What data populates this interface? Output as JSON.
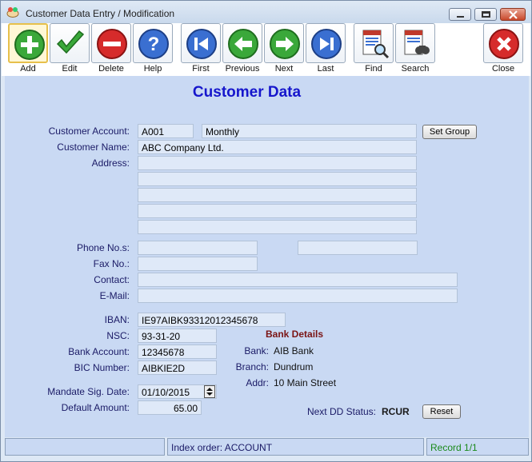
{
  "window": {
    "title": "Customer Data Entry / Modification",
    "controls": [
      "minimize",
      "maximize",
      "close"
    ]
  },
  "toolbar": {
    "buttons": [
      {
        "label": "Add",
        "icon": "add-icon",
        "color": "#3aa83a"
      },
      {
        "label": "Edit",
        "icon": "checkmark-icon",
        "color": "#3aa83a"
      },
      {
        "label": "Delete",
        "icon": "delete-icon",
        "color": "#d62b2b"
      },
      {
        "label": "Help",
        "icon": "help-icon",
        "color": "#3a6fd1"
      },
      {
        "label": "First",
        "icon": "first-record-icon",
        "color": "#3a6fd1"
      },
      {
        "label": "Previous",
        "icon": "previous-icon",
        "color": "#3aa83a"
      },
      {
        "label": "Next",
        "icon": "next-icon",
        "color": "#3aa83a"
      },
      {
        "label": "Last",
        "icon": "last-record-icon",
        "color": "#3a6fd1"
      },
      {
        "label": "Find",
        "icon": "find-icon",
        "color": "#c0392b"
      },
      {
        "label": "Search",
        "icon": "search-icon",
        "color": "#c0392b"
      },
      {
        "label": "Close",
        "icon": "close-icon",
        "color": "#d62b2b"
      }
    ]
  },
  "form": {
    "heading": "Customer Data",
    "labels": {
      "customer_account": "Customer Account:",
      "customer_name": "Customer Name:",
      "address": "Address:",
      "phone": "Phone No.s:",
      "fax": "Fax No.:",
      "contact": "Contact:",
      "email": "E-Mail:",
      "iban": "IBAN:",
      "nsc": "NSC:",
      "bank_account": "Bank Account:",
      "bic": "BIC Number:",
      "mandate_date": "Mandate Sig. Date:",
      "default_amount": "Default Amount:"
    },
    "values": {
      "customer_account": "A001",
      "group": "Monthly",
      "customer_name": "ABC Company Ltd.",
      "address_lines": [
        "",
        "",
        "",
        "",
        ""
      ],
      "phone_1": "",
      "phone_2": "",
      "fax": "",
      "contact": "",
      "email": "",
      "iban": "IE97AIBK93312012345678",
      "nsc": "93-31-20",
      "bank_account": "12345678",
      "bic": "AIBKIE2D",
      "mandate_date": "01/10/2015",
      "default_amount": "65.00"
    },
    "set_group_button": "Set Group",
    "bank_details": {
      "title": "Bank Details",
      "bank_label": "Bank:",
      "bank": "AIB Bank",
      "branch_label": "Branch:",
      "branch": "Dundrum",
      "addr_label": "Addr:",
      "addr": "10 Main Street"
    },
    "next_dd": {
      "label": "Next DD Status:",
      "value": "RCUR",
      "reset_button": "Reset"
    }
  },
  "status_bar": {
    "panel1": "",
    "index_order": "Index order: ACCOUNT",
    "record": "Record 1/1"
  }
}
